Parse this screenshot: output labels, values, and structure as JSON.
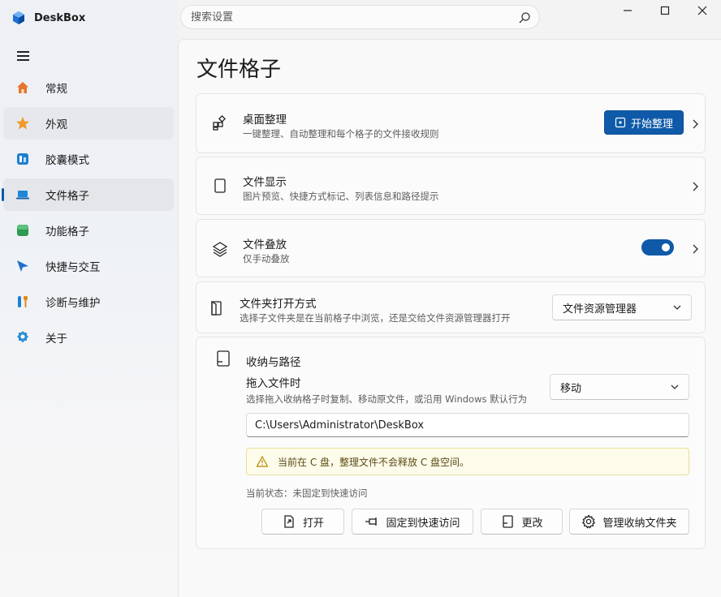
{
  "app": {
    "name": "DeskBox",
    "logo_icon": "deskbox-cube-logo"
  },
  "search": {
    "placeholder": "搜索设置",
    "icon": "search-icon"
  },
  "window_controls": {
    "minimize_icon": "minimize-icon",
    "maximize_icon": "maximize-icon",
    "close_icon": "close-icon"
  },
  "sidebar": {
    "menu_icon": "hamburger-icon",
    "items": [
      {
        "label": "常规",
        "icon": "home-icon",
        "color": "#e8742c"
      },
      {
        "label": "外观",
        "icon": "star-icon",
        "color": "#f09a2a"
      },
      {
        "label": "胶囊模式",
        "icon": "capsule-icon",
        "color": "#1d7fcf"
      },
      {
        "label": "文件格子",
        "icon": "laptop-icon",
        "color": "#1c86d8",
        "active": true
      },
      {
        "label": "功能格子",
        "icon": "green-box-icon",
        "color": "#2e9a52"
      },
      {
        "label": "快捷与交互",
        "icon": "cursor-arrow-icon",
        "color": "#1f6fd1"
      },
      {
        "label": "诊断与维护",
        "icon": "tools-icon",
        "color": "#e0891a"
      },
      {
        "label": "关于",
        "icon": "info-badge-icon",
        "color": "#2a8fd6"
      }
    ]
  },
  "page": {
    "title": "文件格子"
  },
  "cards": {
    "desktop_organize": {
      "icon": "grid-add-icon",
      "title": "桌面整理",
      "desc": "一键整理、自动整理和每个格子的文件接收规则",
      "button_label": "开始整理",
      "button_icon": "organize-icon"
    },
    "file_display": {
      "icon": "file-icon",
      "title": "文件显示",
      "desc": "图片预览、快捷方式标记、列表信息和路径提示"
    },
    "file_stack": {
      "icon": "layers-icon",
      "title": "文件叠放",
      "desc": "仅手动叠放",
      "toggle_on": true
    },
    "folder_open": {
      "icon": "folder-open-icon",
      "title": "文件夹打开方式",
      "desc": "选择子文件夹是在当前格子中浏览，还是交给文件资源管理器打开",
      "select_value": "文件资源管理器"
    },
    "storage": {
      "icon": "storage-icon",
      "title": "收纳与路径",
      "drop_title": "拖入文件时",
      "drop_desc": "选择拖入收纳格子时复制、移动原文件，或沿用 Windows 默认行为",
      "drop_select_value": "移动",
      "path_value": "C:\\Users\\Administrator\\DeskBox",
      "warning": "当前在 C 盘，整理文件不会释放 C 盘空间。",
      "warning_icon": "warning-icon",
      "status": "当前状态：未固定到快速访问",
      "buttons": [
        {
          "label": "打开",
          "icon": "open-file-icon"
        },
        {
          "label": "固定到快速访问",
          "icon": "pin-icon"
        },
        {
          "label": "更改",
          "icon": "change-file-icon"
        },
        {
          "label": "管理收纳文件夹",
          "icon": "gear-icon"
        }
      ]
    }
  },
  "colors": {
    "accent": "#0f5aa8",
    "warning_bg": "#fdfbea"
  }
}
